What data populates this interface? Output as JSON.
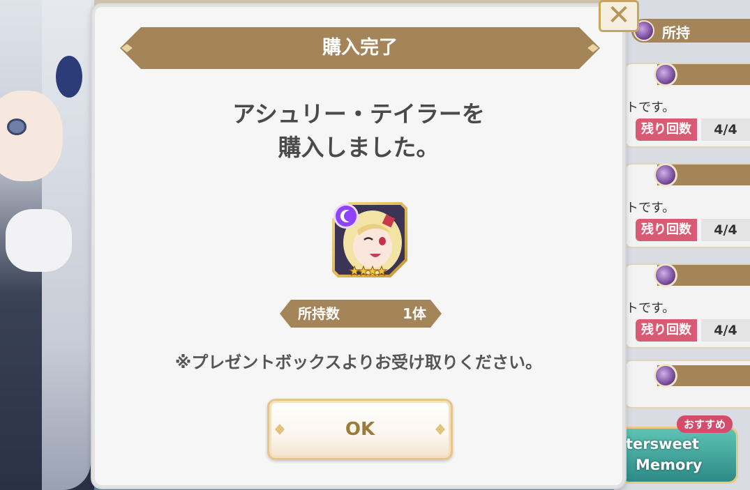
{
  "dialog": {
    "title": "購入完了",
    "message_line1": "アシュリー・テイラーを",
    "message_line2": "購入しました。",
    "owned_label": "所持数",
    "owned_value": "1体",
    "note": "※プレゼントボックスよりお受け取りください。",
    "ok_label": "OK",
    "close_symbol": "✕"
  },
  "character": {
    "rarity_stars": 4,
    "element_icon": "moon-crescent-icon",
    "accent_color": "#8e44ff"
  },
  "background": {
    "owned_header": "所持",
    "items": [
      {
        "text_fragment": "トです。",
        "remain_label": "残り回数",
        "remain_value": "4/4"
      },
      {
        "text_fragment": "トです。",
        "remain_label": "残り回数",
        "remain_value": "4/4"
      },
      {
        "text_fragment": "トです。",
        "remain_label": "残り回数",
        "remain_value": "4/4"
      }
    ],
    "banner_line1": "tersweet",
    "banner_line2": "Memory",
    "recommend_badge": "おすすめ"
  },
  "colors": {
    "gold_banner": "#a38559",
    "remain_badge": "#d85a74",
    "dialog_bg": "#f6f6f6"
  }
}
